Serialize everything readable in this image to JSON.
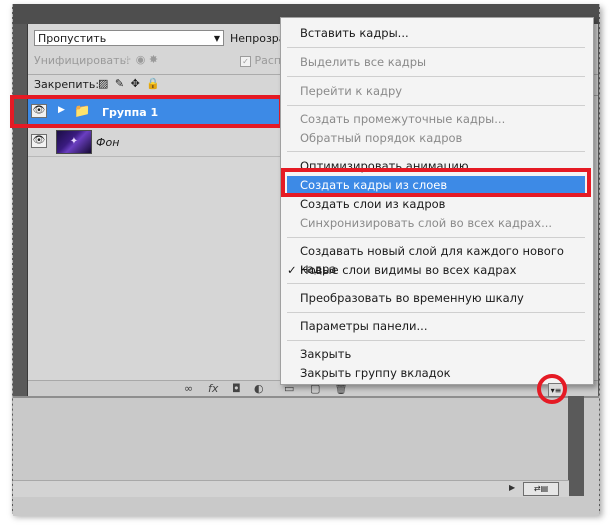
{
  "layers_panel": {
    "blend_mode": "Пропустить",
    "opacity_label": "Непрозрач",
    "unify_label": "Унифицировать:",
    "propagate_label": "Распр",
    "lock_label": "Закрепить:",
    "layers": [
      {
        "name": "Группа 1",
        "type": "group",
        "visible": true,
        "selected": true
      },
      {
        "name": "Фон",
        "type": "image",
        "visible": true,
        "selected": false
      }
    ]
  },
  "icons": {
    "eye": "👁",
    "expand": "▶",
    "folder": "📁",
    "thumb": "✦",
    "chevron": "▼",
    "check": "✓",
    "panel_menu": "▾≡",
    "status_arrow": "▶",
    "status_widget": "⇄▤"
  },
  "bottom_icons": {
    "link": "∞",
    "fx": "fx",
    "mask": "◘",
    "adjust": "◐",
    "group": "▭",
    "new": "▢",
    "trash": "🗑"
  },
  "panel_menu": {
    "items": [
      {
        "label": "Вставить кадры...",
        "enabled": true
      },
      {
        "label": "Выделить все кадры",
        "enabled": false
      },
      {
        "label": "Перейти к кадру",
        "enabled": false
      },
      {
        "label": "Создать промежуточные кадры...",
        "enabled": false
      },
      {
        "label": "Обратный порядок кадров",
        "enabled": false
      },
      {
        "label": "Оптимизировать анимацию...",
        "enabled": true
      },
      {
        "label": "Создать кадры из слоев",
        "enabled": true,
        "highlighted": true
      },
      {
        "label": "Создать слои из кадров",
        "enabled": true
      },
      {
        "label": "Синхронизировать слой во всех кадрах...",
        "enabled": false
      },
      {
        "label": "Создавать новый слой для каждого нового кадра",
        "enabled": true
      },
      {
        "label": "Новые слои видимы во всех кадрах",
        "enabled": true,
        "checked": true
      },
      {
        "label": "Преобразовать во временную шкалу",
        "enabled": true
      },
      {
        "label": "Параметры панели...",
        "enabled": true
      },
      {
        "label": "Закрыть",
        "enabled": true
      },
      {
        "label": "Закрыть группу вкладок",
        "enabled": true
      }
    ]
  },
  "colors": {
    "selection": "#3d8ae6",
    "annotation": "#e51a24"
  }
}
